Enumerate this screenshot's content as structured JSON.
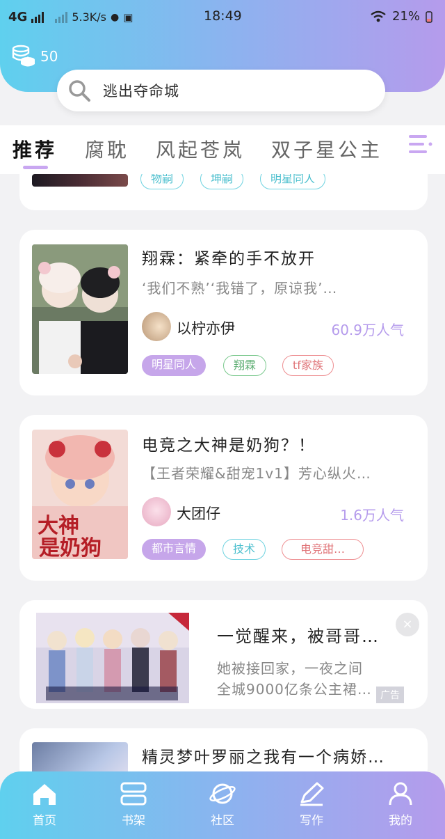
{
  "status_bar": {
    "network": "4G",
    "speed": "5.3K/s",
    "time": "18:49",
    "battery": "21%"
  },
  "coins": {
    "count": "50",
    "icon": "coin-stack-icon"
  },
  "search": {
    "text": "逃出夺命城",
    "icon": "search-icon"
  },
  "tabs": [
    {
      "label": "推荐",
      "active": true
    },
    {
      "label": "腐耽",
      "active": false
    },
    {
      "label": "风起苍岚",
      "active": false
    },
    {
      "label": "双子星公主",
      "active": false
    }
  ],
  "partial_card": {
    "tags": [
      "物嗣",
      "坤嗣",
      "明星同人"
    ]
  },
  "books": [
    {
      "title": "翔霖：紧牵的手不放开",
      "desc": "‘我们不熟’‘我错了，原谅我’…",
      "author": "以柠亦伊",
      "popularity": "60.9万人气",
      "tags": [
        "明星同人",
        "翔霖",
        "tf家族"
      ]
    },
    {
      "title": "电竞之大神是奶狗？！",
      "desc": "【王者荣耀&甜宠1v1】芳心纵火…",
      "author": "大团仔",
      "popularity": "1.6万人气",
      "tags": [
        "都市言情",
        "技术",
        "电竞甜…"
      ],
      "cover_text": "电竞之大神是奶狗"
    }
  ],
  "ad": {
    "title": "一觉醒来，被哥哥…",
    "desc_line1": "她被接回家，一夜之间",
    "desc_line2": "全城9000亿条公主裙…",
    "label": "广告",
    "close": "×"
  },
  "partial_book": {
    "title": "精灵梦叶罗丽之我有一个病娇…"
  },
  "bottom_nav": [
    {
      "label": "首页",
      "icon": "home-icon"
    },
    {
      "label": "书架",
      "icon": "bookshelf-icon"
    },
    {
      "label": "社区",
      "icon": "planet-icon"
    },
    {
      "label": "写作",
      "icon": "pen-icon"
    },
    {
      "label": "我的",
      "icon": "user-icon"
    }
  ],
  "colors": {
    "accent": "#b59bec",
    "gradient_start": "#5fd0ee",
    "gradient_end": "#b59bec"
  }
}
